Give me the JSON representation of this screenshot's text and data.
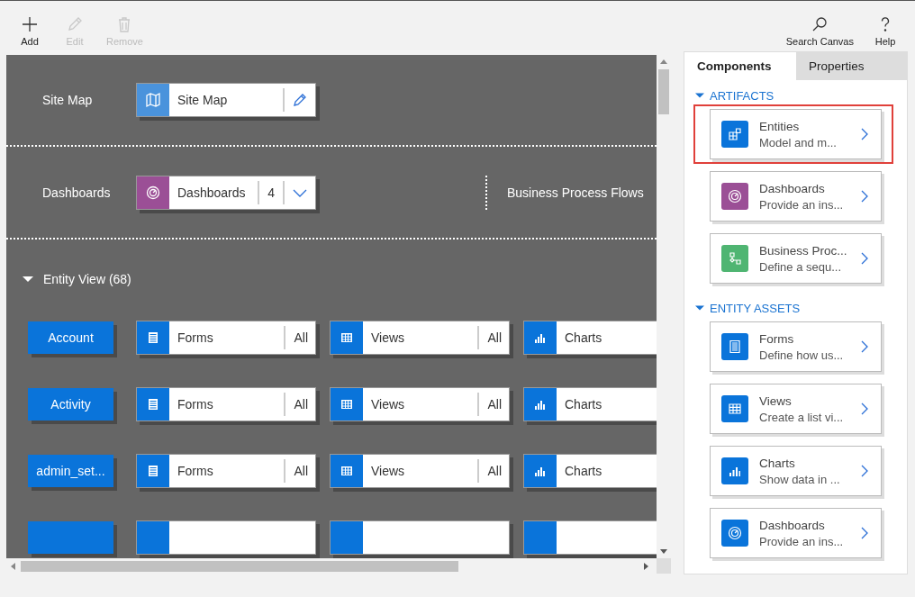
{
  "toolbar": {
    "left": [
      {
        "label": "Add",
        "kind": "add",
        "disabled": false
      },
      {
        "label": "Edit",
        "kind": "edit",
        "disabled": true
      },
      {
        "label": "Remove",
        "kind": "remove",
        "disabled": true
      }
    ],
    "right": [
      {
        "label": "Search Canvas",
        "kind": "search",
        "disabled": false
      },
      {
        "label": "Help",
        "kind": "help",
        "disabled": false
      }
    ]
  },
  "canvas": {
    "site_map": {
      "label": "Site Map",
      "tile": "Site Map"
    },
    "dashboards": {
      "label": "Dashboards",
      "tile": "Dashboards",
      "count": "4"
    },
    "business_process_flows": {
      "label": "Business Process Flows"
    },
    "entity_view": {
      "title": "Entity View (68)",
      "expanded": true,
      "entities": [
        {
          "name": "Account",
          "assets": [
            {
              "kind": "forms",
              "label": "Forms",
              "filter": "All"
            },
            {
              "kind": "views",
              "label": "Views",
              "filter": "All"
            },
            {
              "kind": "charts",
              "label": "Charts"
            }
          ]
        },
        {
          "name": "Activity",
          "assets": [
            {
              "kind": "forms",
              "label": "Forms",
              "filter": "All"
            },
            {
              "kind": "views",
              "label": "Views",
              "filter": "All"
            },
            {
              "kind": "charts",
              "label": "Charts"
            }
          ]
        },
        {
          "name": "admin_set...",
          "assets": [
            {
              "kind": "forms",
              "label": "Forms",
              "filter": "All"
            },
            {
              "kind": "views",
              "label": "Views",
              "filter": "All"
            },
            {
              "kind": "charts",
              "label": "Charts"
            }
          ]
        }
      ]
    }
  },
  "panel": {
    "tabs": [
      {
        "label": "Components",
        "selected": true
      },
      {
        "label": "Properties",
        "selected": false
      }
    ],
    "sections": [
      {
        "title": "ARTIFACTS",
        "expanded": true,
        "cards": [
          {
            "kind": "entities",
            "title": "Entities",
            "description": "Model and m...",
            "color": "#0a74da",
            "highlighted": true
          },
          {
            "kind": "dashboards",
            "title": "Dashboards",
            "description": "Provide an ins...",
            "color": "#9b4f96",
            "highlighted": false
          },
          {
            "kind": "flows",
            "title": "Business Proc...",
            "description": "Define a sequ...",
            "color": "#4fb572",
            "highlighted": false
          }
        ]
      },
      {
        "title": "ENTITY ASSETS",
        "expanded": true,
        "cards": [
          {
            "kind": "forms",
            "title": "Forms",
            "description": "Define how us...",
            "color": "#0a74da",
            "highlighted": false
          },
          {
            "kind": "views",
            "title": "Views",
            "description": "Create a list vi...",
            "color": "#0a74da",
            "highlighted": false
          },
          {
            "kind": "charts",
            "title": "Charts",
            "description": "Show data in ...",
            "color": "#0a74da",
            "highlighted": false
          },
          {
            "kind": "dashboards",
            "title": "Dashboards",
            "description": "Provide an ins...",
            "color": "#0a74da",
            "highlighted": false
          }
        ]
      }
    ]
  }
}
